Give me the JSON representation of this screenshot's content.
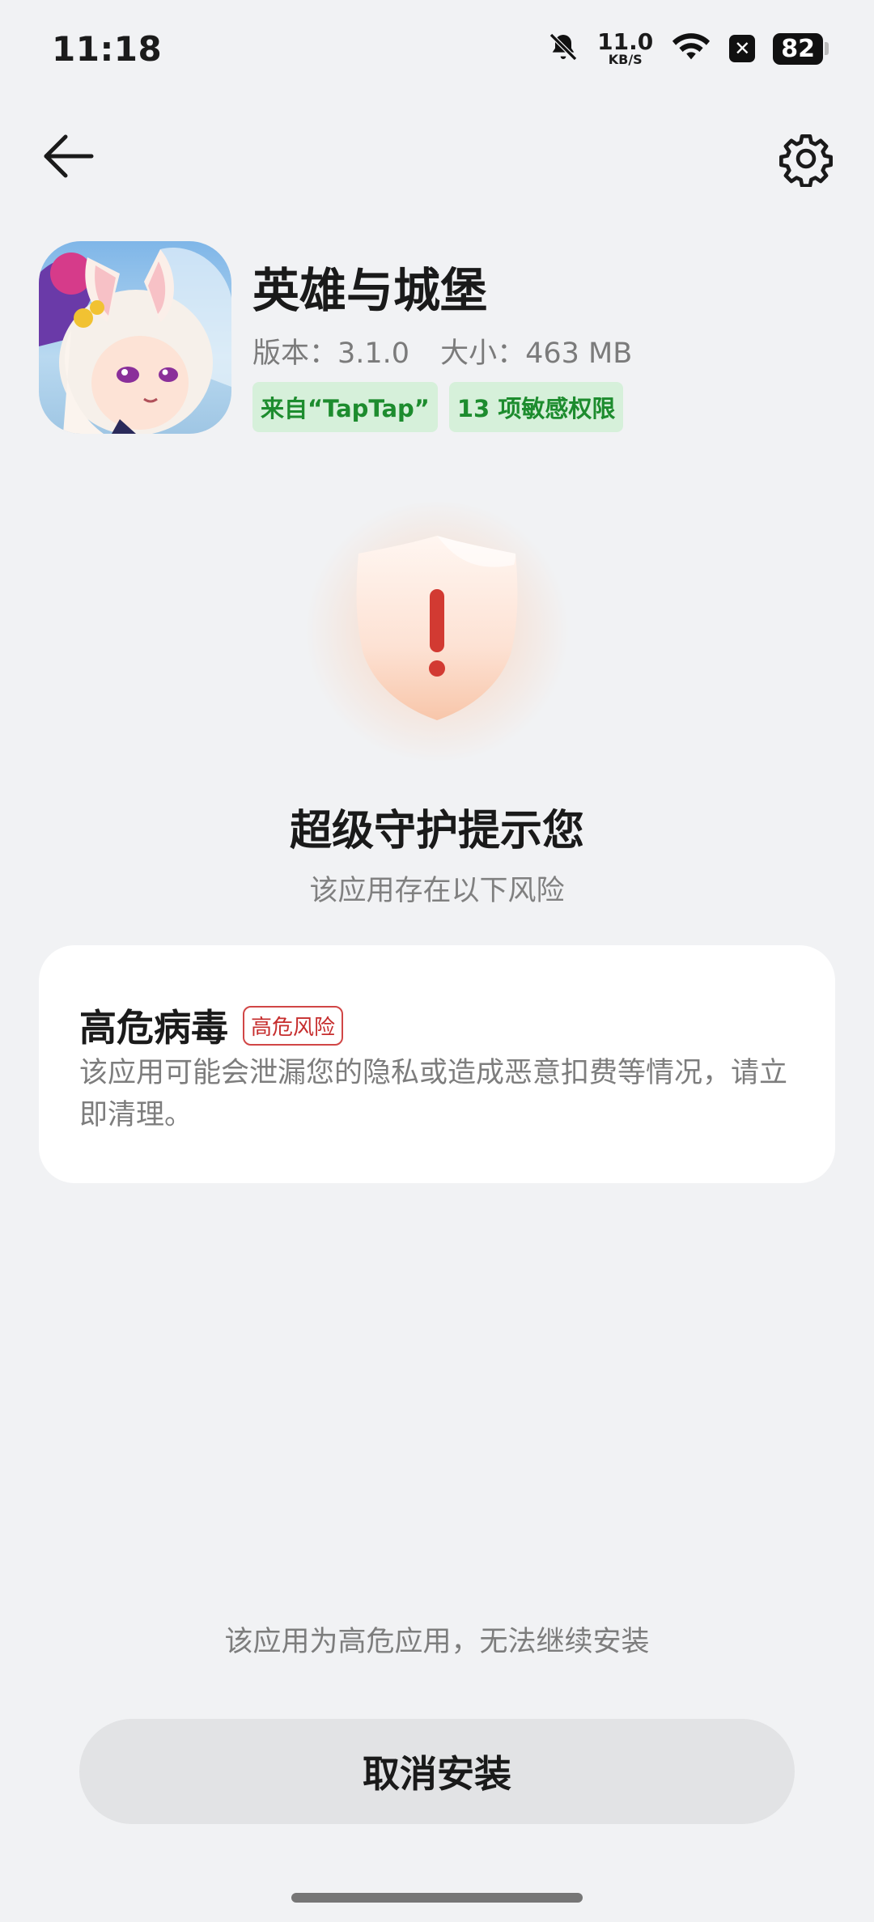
{
  "status_bar": {
    "time": "11:18",
    "net_speed_value": "11.0",
    "net_speed_unit": "KB/S",
    "battery": "82",
    "icons": [
      "bell-muted-icon",
      "wifi-icon",
      "x-badge-icon",
      "battery-icon"
    ]
  },
  "nav": {
    "back_icon": "arrow-left-icon",
    "settings_icon": "gear-icon"
  },
  "app": {
    "name": "英雄与城堡",
    "version": "版本：3.1.0",
    "size": "大小：463 MB",
    "tags": [
      "来自“TapTap”",
      "13 项敏感权限"
    ]
  },
  "guard": {
    "title": "超级守护提示您",
    "subtitle": "该应用存在以下风险"
  },
  "risk": {
    "title": "高危病毒",
    "badge": "高危风险",
    "description": "该应用可能会泄漏您的隐私或造成恶意扣费等情况，请立即清理。"
  },
  "footer": {
    "note": "该应用为高危应用，无法继续安装",
    "cancel_button": "取消安装"
  },
  "colors": {
    "background": "#f1f2f4",
    "tag_bg": "#d6f0da",
    "tag_text": "#1d8c2e",
    "danger": "#c62d2d",
    "button_bg": "#e2e3e5"
  }
}
